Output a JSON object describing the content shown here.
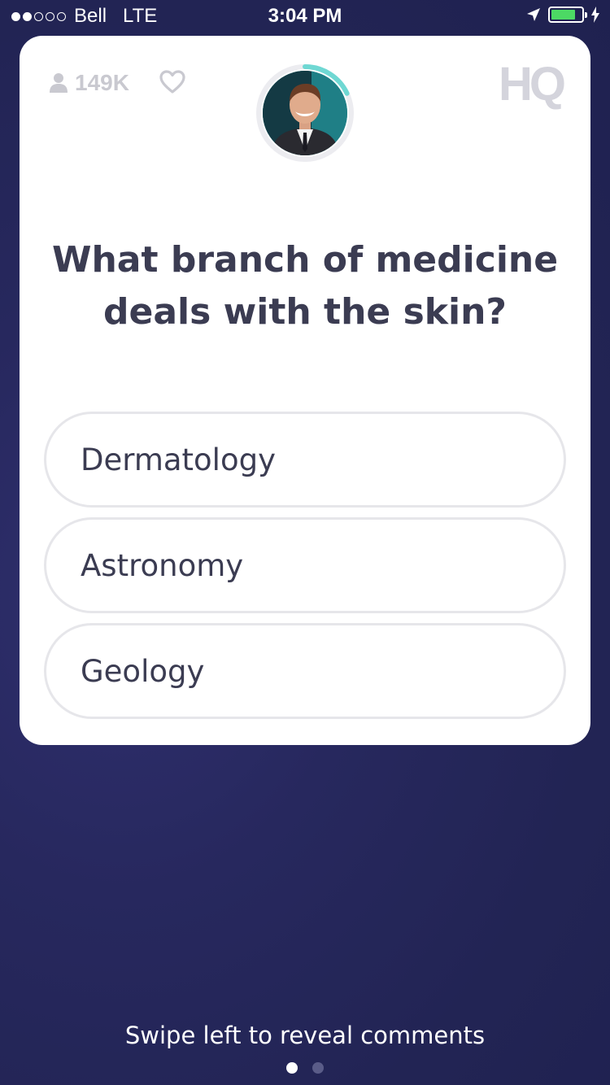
{
  "status_bar": {
    "signal_filled": 2,
    "signal_total": 5,
    "carrier": "Bell",
    "network": "LTE",
    "time": "3:04 PM",
    "battery_level": 0.8,
    "battery_color": "#4cd964"
  },
  "card": {
    "viewers": "149K",
    "viewers_icon": "person-icon",
    "like_icon": "heart-icon",
    "logo": "HQ",
    "host_timer_color": "#6fd8d3",
    "timer_progress": 0.18,
    "question": "What branch of medicine deals with the skin?",
    "answers": [
      {
        "label": "Dermatology"
      },
      {
        "label": "Astronomy"
      },
      {
        "label": "Geology"
      }
    ]
  },
  "footer": {
    "hint": "Swipe left to reveal comments",
    "pages": 2,
    "active_page": 0
  }
}
